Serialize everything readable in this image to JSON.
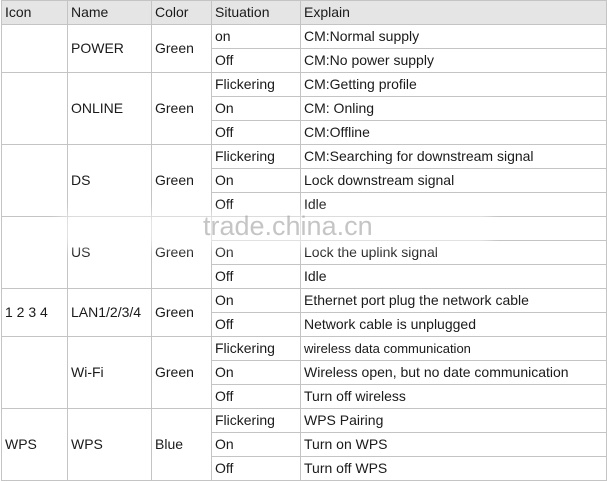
{
  "headers": {
    "icon": "Icon",
    "name": "Name",
    "color": "Color",
    "situation": "Situation",
    "explain": "Explain"
  },
  "rows": [
    {
      "icon": "",
      "name": "POWER",
      "color": "Green",
      "states": [
        {
          "situation": "on",
          "explain": "CM:Normal supply"
        },
        {
          "situation": "Off",
          "explain": "CM:No power supply"
        }
      ]
    },
    {
      "icon": "",
      "name": "ONLINE",
      "color": "Green",
      "states": [
        {
          "situation": "Flickering",
          "explain": "CM:Getting profile"
        },
        {
          "situation": "On",
          "explain": "CM: Onling"
        },
        {
          "situation": "Off",
          "explain": "CM:Offline"
        }
      ]
    },
    {
      "icon": "",
      "name": "DS",
      "color": "Green",
      "states": [
        {
          "situation": "Flickering",
          "explain": "CM:Searching for downstream signal"
        },
        {
          "situation": "On",
          "explain": "Lock downstream signal"
        },
        {
          "situation": "Off",
          "explain": "Idle"
        }
      ]
    },
    {
      "icon": "",
      "name": "US",
      "color": "Green",
      "states": [
        {
          "situation": "",
          "explain": ""
        },
        {
          "situation": "On",
          "explain": "Lock the uplink signal"
        },
        {
          "situation": "Off",
          "explain": "Idle"
        }
      ]
    },
    {
      "icon": "1 2 3 4",
      "name": "LAN1/2/3/4",
      "color": "Green",
      "states": [
        {
          "situation": "On",
          "explain": "Ethernet port plug the network cable"
        },
        {
          "situation": "Off",
          "explain": "Network cable is unplugged"
        }
      ]
    },
    {
      "icon": "",
      "name": "Wi-Fi",
      "color": "Green",
      "states": [
        {
          "situation": "Flickering",
          "explain": "wireless data communication"
        },
        {
          "situation": "On",
          "explain": "Wireless open, but no date communication"
        },
        {
          "situation": "Off",
          "explain": "Turn off wireless"
        }
      ]
    },
    {
      "icon": "WPS",
      "name": "WPS",
      "color": "Blue",
      "states": [
        {
          "situation": "Flickering",
          "explain": "WPS Pairing"
        },
        {
          "situation": "On",
          "explain": "Turn on WPS"
        },
        {
          "situation": "Off",
          "explain": "Turn off WPS"
        }
      ]
    }
  ],
  "watermark": "trade.china.cn"
}
